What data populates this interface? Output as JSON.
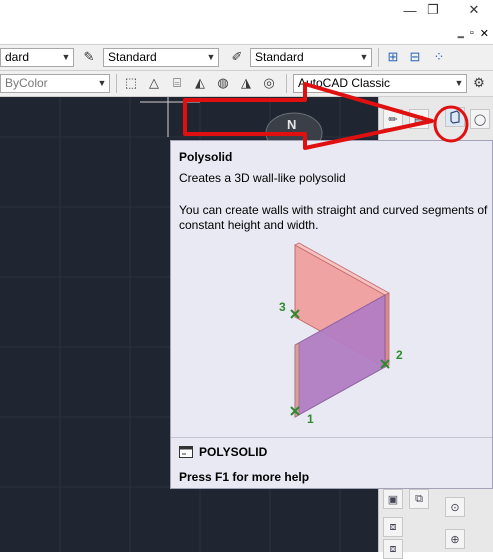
{
  "titlebar": {
    "icons": [
      "minimize-icon",
      "restore-icon",
      "close-icon"
    ],
    "minimize_glyph": "—",
    "restore_glyph": "❐",
    "close_glyph": "✕"
  },
  "toolbar_row1": {
    "style_combo_partial": "dard",
    "text_style_combo": "Standard",
    "dim_style_combo": "Standard"
  },
  "toolbar_row2": {
    "color_combo": "ByColor",
    "workspace_combo": "AutoCAD Classic"
  },
  "compass": {
    "north_label": "N"
  },
  "tooltip": {
    "title": "Polysolid",
    "subtitle": "Creates a 3D wall-like polysolid",
    "description": "You can create walls with straight and curved segments of constant height and width.",
    "illustration_points": [
      "1",
      "2",
      "3"
    ],
    "command": "POLYSOLID",
    "help": "Press F1 for more help"
  },
  "colors": {
    "annotation": "#e01010",
    "drawing_bg": "#1f2531",
    "tooltip_bg": "#e9e9f3"
  }
}
